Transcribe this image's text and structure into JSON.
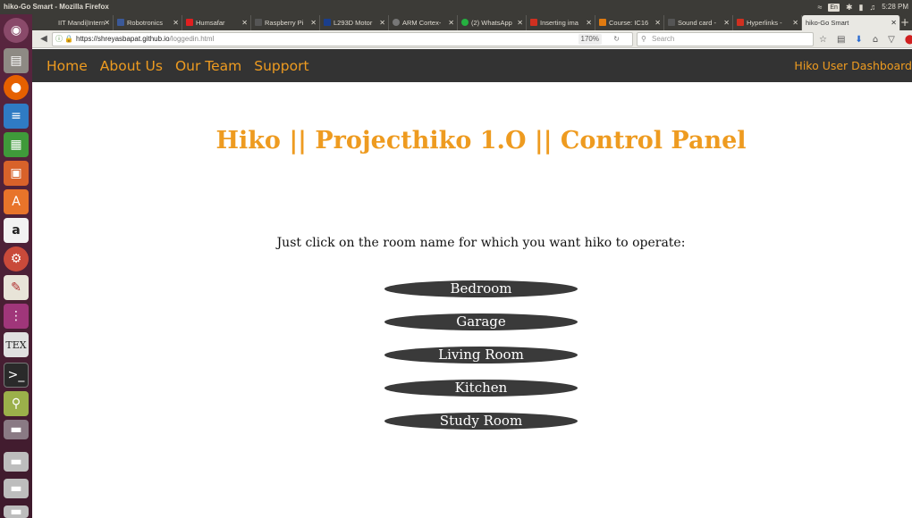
{
  "window": {
    "title": "hiko-Go Smart - Mozilla Firefox"
  },
  "system_tray": {
    "keyboard": "En",
    "time": "5:28 PM"
  },
  "browser": {
    "tabs": [
      {
        "label": "IIT Mandi|Intern",
        "favicon_color": "#3c3b37"
      },
      {
        "label": "Robotronics",
        "favicon_color": "#3b5998"
      },
      {
        "label": "Humsafar",
        "favicon_color": "#e02020"
      },
      {
        "label": "Raspberry Pi",
        "favicon_color": "#555555"
      },
      {
        "label": "L293D Motor",
        "favicon_color": "#1a3e8c"
      },
      {
        "label": "ARM Cortex-",
        "favicon_color": "#777777"
      },
      {
        "label": "(2) WhatsApp",
        "favicon_color": "#25b140"
      },
      {
        "label": "Inserting ima",
        "favicon_color": "#d03020"
      },
      {
        "label": "Course: IC16",
        "favicon_color": "#e07a10"
      },
      {
        "label": "Sound card -",
        "favicon_color": "#555555"
      },
      {
        "label": "Hyperlinks -",
        "favicon_color": "#d03020"
      },
      {
        "label": "hiko-Go Smart",
        "favicon_color": "#e9e8e3",
        "active": true
      }
    ],
    "url_host": "https://shreyasbapat.github.io",
    "url_path": "/loggedin.html",
    "zoom": "170%",
    "search_placeholder": "Search"
  },
  "site": {
    "nav": [
      "Home",
      "About Us",
      "Our Team",
      "Support"
    ],
    "dashboard_link": "Hiko User Dashboard",
    "title": "Hiko || Projecthiko 1.O || Control Panel",
    "instruction": "Just click on the room name for which you want hiko to operate:",
    "rooms": [
      "Bedroom",
      "Garage",
      "Living Room",
      "Kitchen",
      "Study Room"
    ]
  },
  "colors": {
    "accent": "#ee9b20",
    "header_bg": "#333333",
    "room_button_bg": "#3a3a3a",
    "launcher_bg": "#4a1e33"
  },
  "launcher": [
    "ubuntu-dash-icon",
    "files-icon",
    "firefox-icon",
    "writer-icon",
    "calc-icon",
    "impress-icon",
    "software-center-icon",
    "amazon-icon",
    "settings-icon",
    "text-editor-icon",
    "app-icon",
    "texmaker-icon",
    "terminal-icon",
    "search-app-icon",
    "drive-icon",
    "drive-icon",
    "drive-icon",
    "drive-icon"
  ]
}
